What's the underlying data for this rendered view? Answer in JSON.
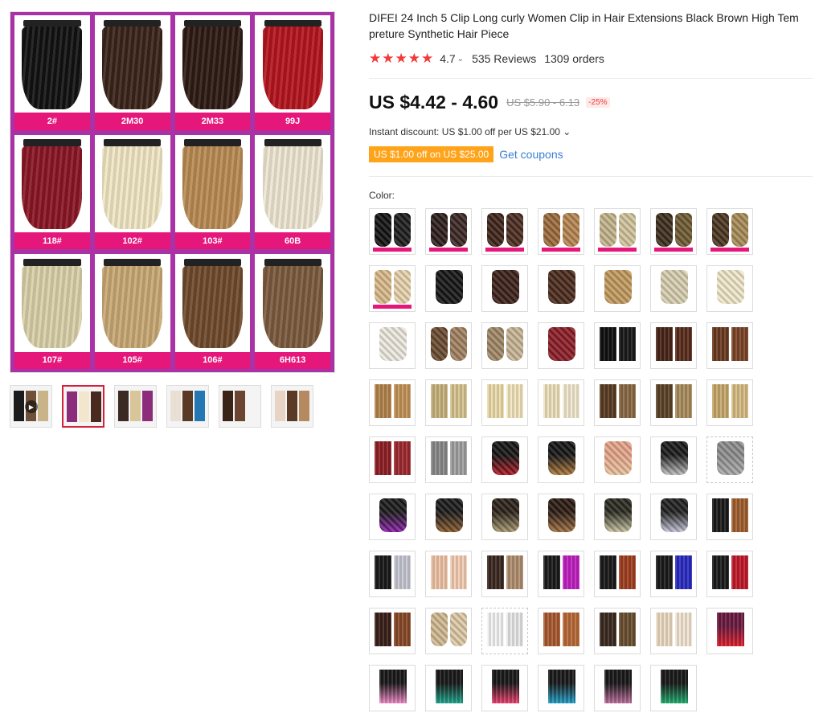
{
  "gallery": {
    "main_swatches": [
      {
        "label": "2#",
        "color": "#121212"
      },
      {
        "label": "2M30",
        "color": "#3a2418"
      },
      {
        "label": "2M33",
        "color": "#2e1b14"
      },
      {
        "label": "99J",
        "color": "#b3141e"
      },
      {
        "label": "118#",
        "color": "#8a1524"
      },
      {
        "label": "102#",
        "color": "#f1e6c4"
      },
      {
        "label": "103#",
        "color": "#b98a52"
      },
      {
        "label": "60B",
        "color": "#eee6d2"
      },
      {
        "label": "107#",
        "color": "#d9cfa8"
      },
      {
        "label": "105#",
        "color": "#c8a875"
      },
      {
        "label": "106#",
        "color": "#6e4a2c"
      },
      {
        "label": "6H613",
        "color": "#7a5a3c"
      }
    ],
    "thumbnails": [
      {
        "name": "thumb-video",
        "kind": "video",
        "colors": [
          "#1b1b1b",
          "#6e5138",
          "#c9b48a"
        ]
      },
      {
        "name": "thumb-grid-selected",
        "kind": "grid",
        "colors": [
          "#8c2d7b",
          "#f2e7cc",
          "#4a2a1e"
        ]
      },
      {
        "name": "thumb-grid-2",
        "kind": "grid",
        "colors": [
          "#3a2a22",
          "#d8c59a",
          "#8c2d7b"
        ]
      },
      {
        "name": "thumb-model",
        "kind": "model",
        "colors": [
          "#e9dfd3",
          "#5a3a24",
          "#2477b3"
        ]
      },
      {
        "name": "thumb-straight",
        "kind": "straight",
        "colors": [
          "#3a2418",
          "#6b4532",
          "#f4f4f4"
        ]
      },
      {
        "name": "thumb-steps",
        "kind": "steps",
        "colors": [
          "#e7d4c4",
          "#5a3a24",
          "#b58a60"
        ]
      }
    ]
  },
  "product": {
    "title": "DIFEI 24 Inch 5 Clip Long curly Women Clip in Hair Extensions Black Brown High Tem preture Synthetic Hair Piece",
    "rating_stars": "★★★★★",
    "rating": "4.7",
    "rating_chevron": "⌄",
    "reviews": "535 Reviews",
    "orders": "1309 orders",
    "price": "US $4.42 - 4.60",
    "original_price": "US $5.90 - 6.13",
    "discount": "-25%",
    "instant_discount": "Instant discount: US $1.00 off per US $21.00 ⌄",
    "coupon_tag": "US $1.00 off on US $25.00",
    "get_coupons": "Get coupons",
    "color_label": "Color:",
    "accent_color": "#f33a3a",
    "coupon_color": "#ffa31a",
    "link_color": "#3b7ed3"
  },
  "color_options": [
    {
      "c1": "#111111",
      "c2": "#1c1c1c",
      "style": "curly",
      "bar": true
    },
    {
      "c1": "#2b1c1a",
      "c2": "#3a2623",
      "style": "curly",
      "bar": true
    },
    {
      "c1": "#3d2318",
      "c2": "#4a2b1f",
      "style": "curly",
      "bar": true
    },
    {
      "c1": "#9a6a3a",
      "c2": "#b58450",
      "style": "curly",
      "bar": true
    },
    {
      "c1": "#c2b38a",
      "c2": "#d1c49c",
      "style": "curly",
      "bar": true
    },
    {
      "c1": "#3c2d1d",
      "c2": "#6e5a32",
      "style": "curly",
      "bar": true
    },
    {
      "c1": "#4a3520",
      "c2": "#a68a55",
      "style": "curly",
      "bar": true
    },
    {
      "c1": "#d8b98a",
      "c2": "#e6d2ac",
      "style": "curly",
      "bar": true
    },
    {
      "c1": "#151515",
      "c2": "#151515",
      "style": "curly single",
      "bar": false
    },
    {
      "c1": "#3b2018",
      "c2": "#3b2018",
      "style": "curly single",
      "bar": false
    },
    {
      "c1": "#4a2a1c",
      "c2": "#4a2a1c",
      "style": "curly single",
      "bar": false
    },
    {
      "c1": "#c29a5e",
      "c2": "#c29a5e",
      "style": "curly single",
      "bar": false
    },
    {
      "c1": "#d7ceb0",
      "c2": "#d7ceb0",
      "style": "curly single",
      "bar": false
    },
    {
      "c1": "#efe6c8",
      "c2": "#efe6c8",
      "style": "curly single",
      "bar": false
    },
    {
      "c1": "#ece8de",
      "c2": "#ece8de",
      "style": "curly single",
      "bar": false
    },
    {
      "c1": "#6a4a30",
      "c2": "#a08060",
      "style": "curly",
      "bar": false
    },
    {
      "c1": "#a08766",
      "c2": "#c7b494",
      "style": "curly",
      "bar": false
    },
    {
      "c1": "#8b1c26",
      "c2": "#8b1c26",
      "style": "curly single",
      "bar": false
    },
    {
      "c1": "#101010",
      "c2": "#1a1a1a",
      "style": "straight",
      "bar": false
    },
    {
      "c1": "#4a2418",
      "c2": "#5a2c1c",
      "style": "straight",
      "bar": false
    },
    {
      "c1": "#6b3a20",
      "c2": "#7c4528",
      "style": "straight",
      "bar": false
    },
    {
      "c1": "#b5844c",
      "c2": "#c4955a",
      "style": "straight",
      "bar": false
    },
    {
      "c1": "#c9b47e",
      "c2": "#d6c48f",
      "style": "straight",
      "bar": false
    },
    {
      "c1": "#ecdcaa",
      "c2": "#f3e6bd",
      "style": "straight",
      "bar": false
    },
    {
      "c1": "#eee2bd",
      "c2": "#f3ead0",
      "style": "straight",
      "bar": false
    },
    {
      "c1": "#5a3c22",
      "c2": "#8a6a44",
      "style": "straight",
      "bar": false
    },
    {
      "c1": "#5c4428",
      "c2": "#a88c5c",
      "style": "straight",
      "bar": false
    },
    {
      "c1": "#c8a86c",
      "c2": "#d8bc84",
      "style": "straight",
      "bar": false
    },
    {
      "c1": "#8e1f26",
      "c2": "#9e2a30",
      "style": "straight",
      "bar": false
    },
    {
      "c1": "#8a8a8a",
      "c2": "#a0a0a0",
      "style": "straight",
      "bar": false
    },
    {
      "c1": "#141414",
      "c2": "#b01822",
      "style": "curly single",
      "bar": false
    },
    {
      "c1": "#141414",
      "c2": "#b07a3a",
      "style": "curly single",
      "bar": false
    },
    {
      "c1": "#e4a48a",
      "c2": "#e9c29c",
      "style": "curly single",
      "bar": false
    },
    {
      "c1": "#1a1a1a",
      "c2": "#c0c0c0",
      "style": "curly single",
      "bar": false
    },
    {
      "c1": "#8c8c8c",
      "c2": "#a8a8a8",
      "style": "curly single dashed",
      "bar": false
    },
    {
      "c1": "#1a1a1a",
      "c2": "#8a1fa8",
      "style": "curly single",
      "bar": false
    },
    {
      "c1": "#1a1a1a",
      "c2": "#8a5a2a",
      "style": "curly single",
      "bar": false
    },
    {
      "c1": "#2a2018",
      "c2": "#a89a70",
      "style": "curly single",
      "bar": false
    },
    {
      "c1": "#2a1a12",
      "c2": "#a07040",
      "style": "curly single",
      "bar": false
    },
    {
      "c1": "#2a2a20",
      "c2": "#c8c4a0",
      "style": "curly single",
      "bar": false
    },
    {
      "c1": "#202020",
      "c2": "#c4c4d8",
      "style": "curly single",
      "bar": false
    },
    {
      "c1": "#1a1a1a",
      "c2": "#a06030",
      "style": "straight",
      "bar": false
    },
    {
      "c1": "#1a1a1a",
      "c2": "#c8c8d4",
      "style": "straight",
      "bar": false
    },
    {
      "c1": "#f0c4a8",
      "c2": "#f4cdb4",
      "style": "straight",
      "bar": false
    },
    {
      "c1": "#3a2820",
      "c2": "#b09070",
      "style": "straight",
      "bar": false
    },
    {
      "c1": "#1a1a1a",
      "c2": "#c020c0",
      "style": "straight",
      "bar": false
    },
    {
      "c1": "#1a1a1a",
      "c2": "#a04020",
      "style": "straight",
      "bar": false
    },
    {
      "c1": "#1a1a1a",
      "c2": "#2a2ac0",
      "style": "straight",
      "bar": false
    },
    {
      "c1": "#1a1a1a",
      "c2": "#c01a2a",
      "style": "straight",
      "bar": false
    },
    {
      "c1": "#3a2018",
      "c2": "#8a4a28",
      "style": "straight",
      "bar": false
    },
    {
      "c1": "#d0b890",
      "c2": "#dcc8a4",
      "style": "curly",
      "bar": false
    },
    {
      "c1": "#f4f4f4",
      "c2": "#e8e8e8",
      "style": "straight dashed",
      "bar": false
    },
    {
      "c1": "#a85a30",
      "c2": "#b86a38",
      "style": "straight",
      "bar": false
    },
    {
      "c1": "#3a2a20",
      "c2": "#6a5030",
      "style": "straight",
      "bar": false
    },
    {
      "c1": "#ecdcc4",
      "c2": "#f2e6d4",
      "style": "straight",
      "bar": false
    },
    {
      "c1": "#6a1a40",
      "c2": "#e0202a",
      "style": "straight single",
      "bar": false
    },
    {
      "c1": "#1a1a1a",
      "c2": "#f08ac8",
      "style": "straight single",
      "bar": false
    },
    {
      "c1": "#1a1a1a",
      "c2": "#20a890",
      "style": "straight single",
      "bar": false
    },
    {
      "c1": "#1a1a1a",
      "c2": "#f04070",
      "style": "straight single",
      "bar": false
    },
    {
      "c1": "#1a1a1a",
      "c2": "#20a0c8",
      "style": "straight single",
      "bar": false
    },
    {
      "c1": "#1a1a1a",
      "c2": "#c070a0",
      "style": "straight single",
      "bar": false
    },
    {
      "c1": "#1a1a1a",
      "c2": "#20b070",
      "style": "straight single",
      "bar": false
    }
  ]
}
